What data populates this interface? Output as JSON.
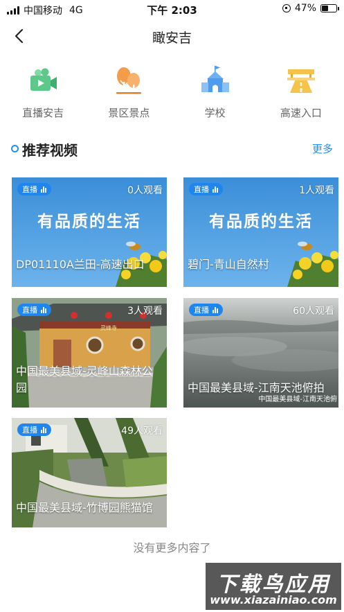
{
  "status_bar": {
    "carrier": "中国移动",
    "network": "4G",
    "time": "下午 2:03",
    "battery": "47%",
    "battery_level": 0.47
  },
  "nav": {
    "title": "瞰安吉"
  },
  "categories": [
    {
      "label": "直播安吉",
      "icon": "live-camera-icon",
      "color": "#5cc98a"
    },
    {
      "label": "景区景点",
      "icon": "scenic-trees-icon",
      "color": "#f39c4a"
    },
    {
      "label": "学校",
      "icon": "school-icon",
      "color": "#4d9cf0"
    },
    {
      "label": "高速入口",
      "icon": "highway-icon",
      "color": "#f5c34a"
    }
  ],
  "section": {
    "title": "推荐视频",
    "more": "更多"
  },
  "videos": [
    {
      "badge": "直播",
      "viewers": "0人观看",
      "title": "DP01110A兰田-高速出口",
      "slogan": "有品质的生活"
    },
    {
      "badge": "直播",
      "viewers": "1人观看",
      "title": "碧门-青山自然村",
      "slogan": "有品质的生活"
    },
    {
      "badge": "直播",
      "viewers": "3人观看",
      "title": "中国最美县域-灵峰山森林公园",
      "sign": "灵峰寺"
    },
    {
      "badge": "直播",
      "viewers": "60人观看",
      "title": "中国最美县域-江南天池俯拍",
      "overlay": "中国最美县域-江南天池俯"
    },
    {
      "badge": "直播",
      "viewers": "49人观看",
      "title": "中国最美县域-竹博园熊猫馆"
    }
  ],
  "footer": {
    "no_more": "没有更多内容了"
  },
  "watermark": {
    "cn": "下载鸟应用",
    "en": "www.xiazainiao.com"
  },
  "colors": {
    "accent": "#2a8cf0",
    "badge": "#1f86f0"
  }
}
